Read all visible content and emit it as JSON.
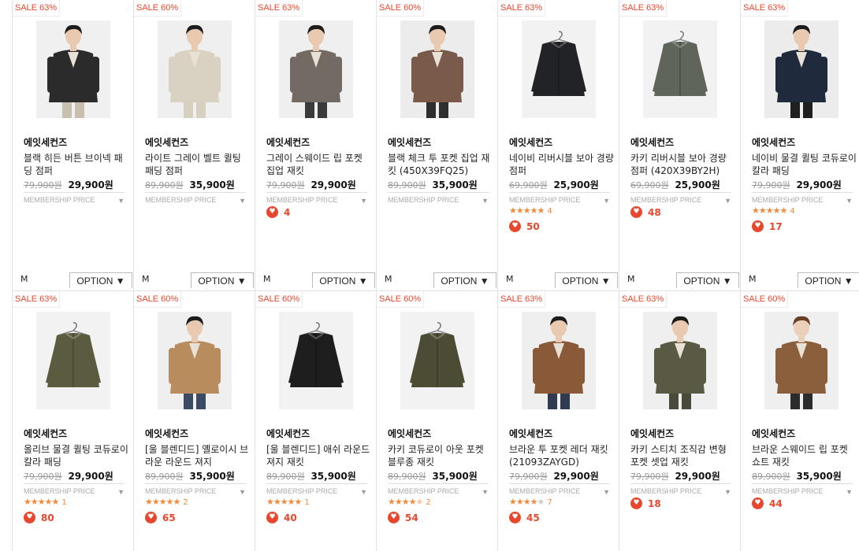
{
  "ui": {
    "membership_label": "MEMBERSHIP PRICE",
    "option_label": "OPTION ▼",
    "size_label": "M"
  },
  "products": [
    {
      "sale": "SALE 63%",
      "brand": "에잇세컨즈",
      "title": "블랙 히든 버튼 브이넥 패딩 점퍼",
      "old": "79,900원",
      "price": "29,900원",
      "stars": null,
      "reviews": null,
      "likes": null,
      "colors": {
        "bg": "#f0f0f0",
        "garment": "#2b2b2b",
        "skin": "#e9c9b0",
        "hair": "#1c1c1c",
        "pants": "#c8bfae"
      },
      "icon": "model"
    },
    {
      "sale": "SALE 60%",
      "brand": "에잇세컨즈",
      "title": "라이트 그레이 벨트 퀼팅 패딩 점퍼",
      "old": "89,900원",
      "price": "35,900원",
      "stars": null,
      "reviews": null,
      "likes": null,
      "colors": {
        "bg": "#efefef",
        "garment": "#d9d2c2",
        "skin": "#e9c9b0",
        "hair": "#1c1c1c",
        "pants": "#d7cfbf"
      },
      "icon": "model"
    },
    {
      "sale": "SALE 63%",
      "brand": "에잇세컨즈",
      "title": "그레이 스웨이드 립 포켓 집업 재킷",
      "old": "79,900원",
      "price": "29,900원",
      "stars": null,
      "reviews": null,
      "likes": "4",
      "colors": {
        "bg": "#efefef",
        "garment": "#746a64",
        "skin": "#e9c9b0",
        "hair": "#1c1c1c",
        "pants": "#3a3a3a"
      },
      "icon": "model"
    },
    {
      "sale": "SALE 60%",
      "brand": "에잇세컨즈",
      "title": "블랙 체크 투 포켓 집업 재킷 (450X39FQ25)",
      "old": "89,900원",
      "price": "35,900원",
      "stars": null,
      "reviews": null,
      "likes": null,
      "colors": {
        "bg": "#ececec",
        "garment": "#7a5a4a",
        "skin": "#e9c9b0",
        "hair": "#1c1c1c",
        "pants": "#2e2e2e"
      },
      "icon": "model"
    },
    {
      "sale": "SALE 63%",
      "brand": "에잇세컨즈",
      "title": "네이비 리버시블 보아 경량 점퍼",
      "old": "69,900원",
      "price": "25,900원",
      "stars": "★★★★★",
      "reviews": "4",
      "likes": "50",
      "colors": {
        "bg": "#f2f2f2",
        "garment": "#222326",
        "skin": "#000000",
        "hair": "#000000",
        "pants": "#000000"
      },
      "icon": "hanger"
    },
    {
      "sale": "SALE 63%",
      "brand": "에잇세컨즈",
      "title": "카키 리버시블 보아 경량 점퍼 (420X39BY2H)",
      "old": "69,900원",
      "price": "25,900원",
      "stars": null,
      "reviews": null,
      "likes": "48",
      "colors": {
        "bg": "#f2f2f2",
        "garment": "#5f6558",
        "skin": "#000000",
        "hair": "#000000",
        "pants": "#000000"
      },
      "icon": "hanger"
    },
    {
      "sale": "SALE 63%",
      "brand": "에잇세컨즈",
      "title": "네이비 물결 퀼팅 코듀로이 칼라 패딩",
      "old": "79,900원",
      "price": "29,900원",
      "stars": "★★★★★",
      "reviews": "4",
      "likes": "17",
      "colors": {
        "bg": "#ececec",
        "garment": "#1f2a3d",
        "skin": "#e9c9b0",
        "hair": "#1c1c1c",
        "pants": "#1f1f1f"
      },
      "icon": "model"
    },
    {
      "sale": "SALE 63%",
      "brand": "에잇세컨즈",
      "title": "올리브 물결 퀼팅 코듀로이 칼라 패딩",
      "old": "79,900원",
      "price": "29,900원",
      "stars": "★★★★★",
      "reviews": "1",
      "likes": "80",
      "colors": {
        "bg": "#f2f2f2",
        "garment": "#5b5c3f",
        "skin": "#000000",
        "hair": "#000000",
        "pants": "#000000"
      },
      "icon": "hanger"
    },
    {
      "sale": "SALE 60%",
      "brand": "에잇세컨즈",
      "title": "[울 블렌디드] 옐로이시 브라운 라운드 져지",
      "old": "89,900원",
      "price": "35,900원",
      "stars": "★★★★★",
      "reviews": "2",
      "likes": "65",
      "colors": {
        "bg": "#efefef",
        "garment": "#b88c5c",
        "skin": "#e9c9b0",
        "hair": "#1c1c1c",
        "pants": "#3c4a63"
      },
      "icon": "model"
    },
    {
      "sale": "SALE 60%",
      "brand": "에잇세컨즈",
      "title": "[울 블렌디드] 애쉬 라운드 져지 재킷",
      "old": "89,900원",
      "price": "35,900원",
      "stars": "★★★★★",
      "reviews": "1",
      "likes": "40",
      "colors": {
        "bg": "#f2f2f2",
        "garment": "#1e1e1e",
        "skin": "#000000",
        "hair": "#000000",
        "pants": "#000000"
      },
      "icon": "hanger"
    },
    {
      "sale": "SALE 60%",
      "brand": "에잇세컨즈",
      "title": "카키 코듀로이 아웃 포켓 블루종 재킷",
      "old": "89,900원",
      "price": "35,900원",
      "stars": "★★★★",
      "stars_half": "★",
      "reviews": "2",
      "likes": "54",
      "colors": {
        "bg": "#f2f2f2",
        "garment": "#4c4c35",
        "skin": "#000000",
        "hair": "#000000",
        "pants": "#000000"
      },
      "icon": "hanger"
    },
    {
      "sale": "SALE 63%",
      "brand": "에잇세컨즈",
      "title": "브라운 투 포켓 레더 재킷 (21093ZAYGD)",
      "old": "79,900원",
      "price": "29,900원",
      "stars": "★★★★",
      "stars_dim": "★",
      "reviews": "7",
      "likes": "45",
      "colors": {
        "bg": "#efefef",
        "garment": "#8a5a38",
        "skin": "#e9c9b0",
        "hair": "#1c1c1c",
        "pants": "#2f3b52"
      },
      "icon": "model"
    },
    {
      "sale": "SALE 63%",
      "brand": "에잇세컨즈",
      "title": "카키 스티치 조직감 변형 포켓 셋업 재킷",
      "old": "79,900원",
      "price": "29,900원",
      "stars": null,
      "reviews": null,
      "likes": "18",
      "colors": {
        "bg": "#efefef",
        "garment": "#5a5a44",
        "skin": "#e9c9b0",
        "hair": "#1c1c1c",
        "pants": "#4a4a3a"
      },
      "icon": "model"
    },
    {
      "sale": "SALE 60%",
      "brand": "에잇세컨즈",
      "title": "브라운 스웨이드 립 포켓 쇼트 재킷",
      "old": "89,900원",
      "price": "35,900원",
      "stars": null,
      "reviews": null,
      "likes": "44",
      "colors": {
        "bg": "#efefef",
        "garment": "#8b5e3c",
        "skin": "#ead0bb",
        "hair": "#6a3e22",
        "pants": "#2c2c2c"
      },
      "icon": "model"
    }
  ]
}
